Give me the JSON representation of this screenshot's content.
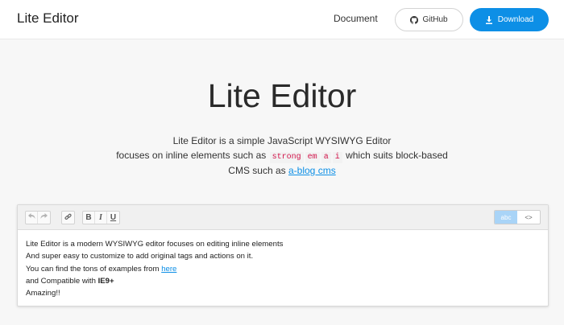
{
  "header": {
    "brand": "Lite Editor",
    "nav_document": "Document",
    "github_label": "GitHub",
    "download_label": "Download",
    "colors": {
      "primary": "#0d8fe6",
      "background": "#f7f7f7"
    }
  },
  "hero": {
    "title": "Lite Editor",
    "line1": "Lite Editor is a simple JavaScript WYSIWYG Editor",
    "line2_prefix": "focuses on inline elements such as",
    "code_tags": [
      "strong",
      "em",
      "a",
      "i"
    ],
    "line2_suffix": "which suits block-based",
    "line3_prefix": "CMS such as",
    "line3_link": "a-blog cms"
  },
  "editor": {
    "toolbar": {
      "undo_icon": "undo-icon",
      "redo_icon": "redo-icon",
      "link_icon": "link-icon",
      "bold_label": "B",
      "italic_label": "I",
      "underline_label": "U",
      "mode_text_label": "abc",
      "mode_source_label": "<>"
    },
    "content": {
      "line1": "Lite Editor is a modern WYSIWYG editor focuses on editing inline elements",
      "line2": "And super easy to customize to add original tags and actions on it.",
      "line3_prefix": "You can find the tons of examples from",
      "line3_link": "here",
      "line4_prefix": "and Compatible with",
      "line4_strong": "IE9+",
      "line5": "Amazing!!"
    }
  }
}
